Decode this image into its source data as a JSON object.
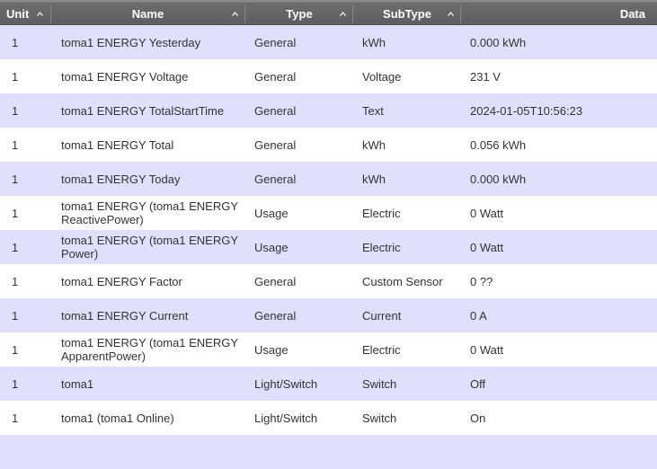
{
  "columns": {
    "unit": "Unit",
    "name": "Name",
    "type": "Type",
    "subtype": "SubType",
    "data": "Data"
  },
  "rows": [
    {
      "unit": "1",
      "name": "toma1 ENERGY Yesterday",
      "type": "General",
      "subtype": "kWh",
      "data": "0.000 kWh"
    },
    {
      "unit": "1",
      "name": "toma1 ENERGY Voltage",
      "type": "General",
      "subtype": "Voltage",
      "data": "231 V"
    },
    {
      "unit": "1",
      "name": "toma1 ENERGY TotalStartTime",
      "type": "General",
      "subtype": "Text",
      "data": "2024-01-05T10:56:23"
    },
    {
      "unit": "1",
      "name": "toma1 ENERGY Total",
      "type": "General",
      "subtype": "kWh",
      "data": "0.056 kWh"
    },
    {
      "unit": "1",
      "name": "toma1 ENERGY Today",
      "type": "General",
      "subtype": "kWh",
      "data": "0.000 kWh"
    },
    {
      "unit": "1",
      "name": "toma1 ENERGY (toma1 ENERGY ReactivePower)",
      "type": "Usage",
      "subtype": "Electric",
      "data": "0 Watt"
    },
    {
      "unit": "1",
      "name": "toma1 ENERGY (toma1 ENERGY Power)",
      "type": "Usage",
      "subtype": "Electric",
      "data": "0 Watt"
    },
    {
      "unit": "1",
      "name": "toma1 ENERGY Factor",
      "type": "General",
      "subtype": "Custom Sensor",
      "data": "0 ??"
    },
    {
      "unit": "1",
      "name": "toma1 ENERGY Current",
      "type": "General",
      "subtype": "Current",
      "data": "0 A"
    },
    {
      "unit": "1",
      "name": "toma1 ENERGY (toma1 ENERGY ApparentPower)",
      "type": "Usage",
      "subtype": "Electric",
      "data": "0 Watt"
    },
    {
      "unit": "1",
      "name": "toma1",
      "type": "Light/Switch",
      "subtype": "Switch",
      "data": "Off"
    },
    {
      "unit": "1",
      "name": "toma1 (toma1 Online)",
      "type": "Light/Switch",
      "subtype": "Switch",
      "data": "On"
    },
    {
      "unit": "",
      "name": "",
      "type": "",
      "subtype": "",
      "data": ""
    }
  ],
  "colors": {
    "header_bg": "#5e5e5e",
    "row_odd": "#e0e0fc",
    "row_even": "#ffffff",
    "text": "#333333"
  }
}
